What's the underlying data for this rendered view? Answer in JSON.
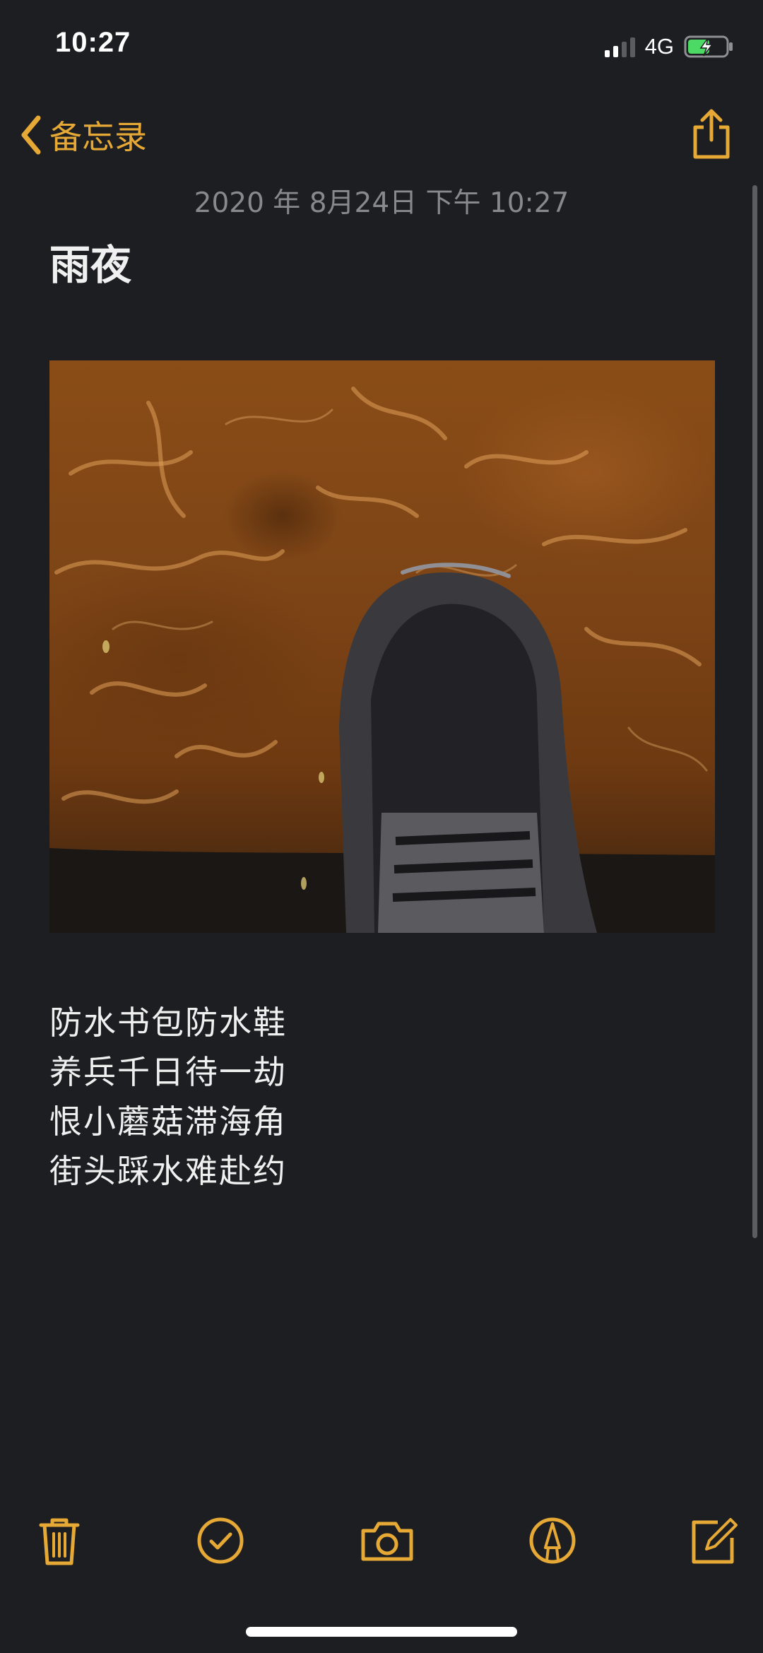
{
  "status_bar": {
    "time": "10:27",
    "network": "4G",
    "signal_bars_filled": 2,
    "signal_bars_total": 4,
    "battery_state": "charging"
  },
  "nav": {
    "back_label": "备忘录",
    "back_icon": "chevron-left-icon",
    "share_icon": "share-icon"
  },
  "note": {
    "date": "2020 年 8月24日 下午 10:27",
    "title": "雨夜",
    "lines": [
      "防水书包防水鞋",
      "养兵千日待一劫",
      "恨小蘑菇滞海角",
      "街头踩水难赴约"
    ]
  },
  "toolbar": {
    "delete_icon": "trash-icon",
    "checklist_icon": "checkmark-circle-icon",
    "camera_icon": "camera-icon",
    "markup_icon": "pen-markup-icon",
    "compose_icon": "compose-icon"
  },
  "colors": {
    "accent": "#e7a935",
    "background": "#1d1e21",
    "text": "#f0f0f0",
    "date_text": "#88898c",
    "battery_green": "#4cd964"
  }
}
